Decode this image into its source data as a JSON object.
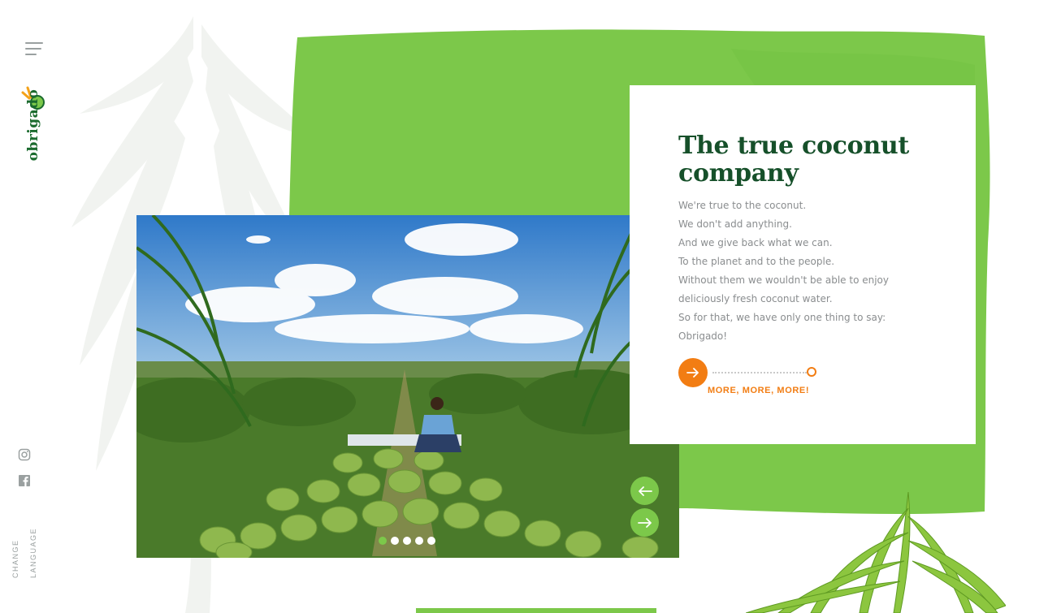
{
  "brand": {
    "logo_text": "obrigado",
    "colors": {
      "green": "#7cc84a",
      "dark_green": "#16502a",
      "orange": "#f27d13",
      "text_grey": "#8a8d8f"
    }
  },
  "nav": {
    "menu_icon": "hamburger-menu-icon"
  },
  "social": [
    {
      "name": "instagram",
      "icon": "instagram-icon"
    },
    {
      "name": "facebook",
      "icon": "facebook-icon"
    }
  ],
  "language": {
    "line1": "CHANGE",
    "line2": "LANGUAGE"
  },
  "hero": {
    "title": "The true coconut company",
    "paragraphs": [
      "We're true to the coconut.",
      "We don't add anything.",
      "And we give back what we can.",
      "To the planet and to the people.",
      "Without them we wouldn't be able to enjoy",
      "deliciously fresh coconut water.",
      "So for that, we have only one thing to say:",
      "Obrigado!"
    ],
    "cta_label": "MORE, MORE, MORE!"
  },
  "slider": {
    "slide_count": 5,
    "active_index": 0,
    "prev_icon": "arrow-left-icon",
    "next_icon": "arrow-right-icon"
  }
}
